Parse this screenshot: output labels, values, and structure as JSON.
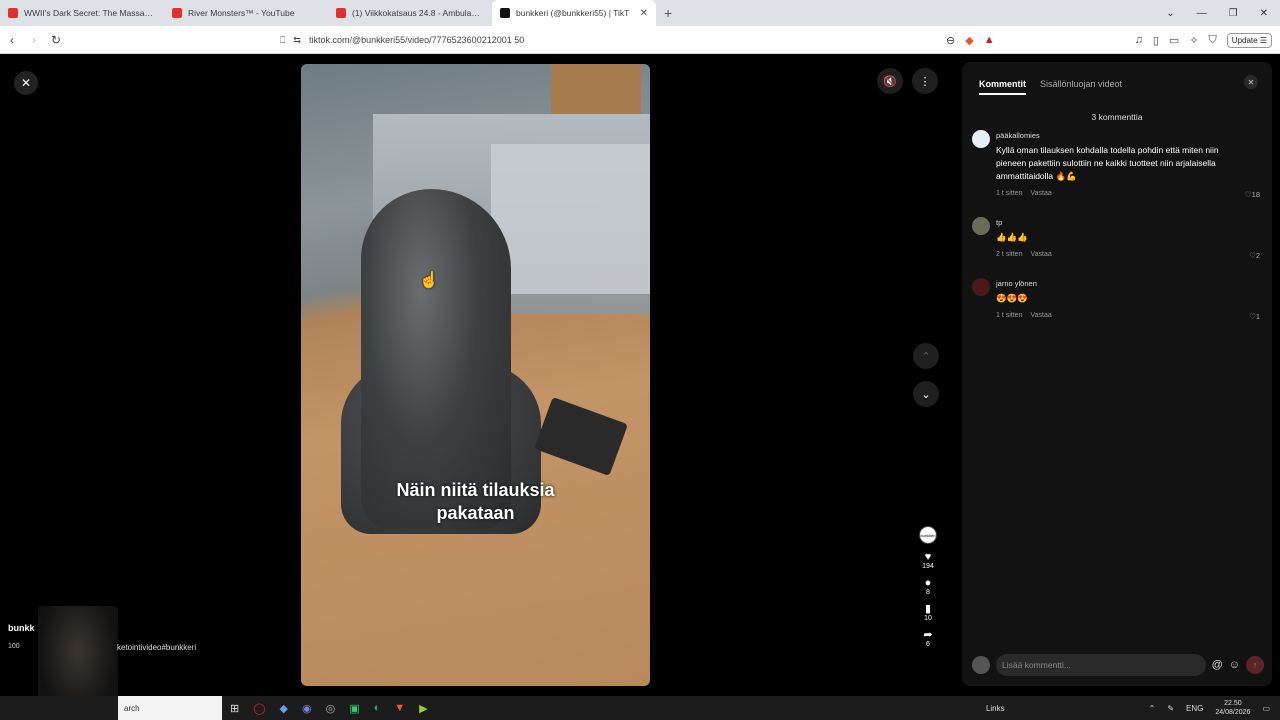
{
  "browser": {
    "tabs": [
      {
        "title": "WWII's Dark Secret: The Massacre of",
        "fav_color": "#e03030"
      },
      {
        "title": "River Monsters™ - YouTube",
        "fav_color": "#e03030"
      },
      {
        "title": "(1) Viikkokatsaus 24.8 - Ambulanssia",
        "fav_color": "#e03030"
      },
      {
        "title": "bunkkeri (@bunkkeri55) | TikT",
        "fav_color": "#111111",
        "active": true
      }
    ],
    "new_tab": "+",
    "url": "tiktok.com/@bunkkeri55/video/7776523600212001 50",
    "update_label": "Update"
  },
  "viewer": {
    "caption_line1": "Näin niitä tilauksia",
    "caption_line2": "pakataan",
    "creator_avatar_text": "bunkkeri",
    "likes": "194",
    "comments": "8",
    "saves": "10",
    "shares": "6"
  },
  "overlay": {
    "name": "bunkk",
    "count": "100",
    "desc": "ketointivideo#bunkkeri"
  },
  "panel": {
    "tab_comments": "Kommentit",
    "tab_creator_videos": "Sisällönluojan videot",
    "comment_count": "3 kommenttia",
    "comments": [
      {
        "user": "pääkallomies",
        "text": "Kyllä oman tilauksen kohdalla todella pohdin että miten niin pieneen pakettiin sulottiin ne kaikki tuotteet niin arjalaisella ammattitaidolla 🔥💪",
        "time": "1 t sitten",
        "reply": "Vastaa",
        "likes": "18",
        "avatar_color": "#e8eef5"
      },
      {
        "user": "tp",
        "text": "👍👍👍",
        "time": "2 t sitten",
        "reply": "Vastaa",
        "likes": "2",
        "avatar_color": "#6b6b5a"
      },
      {
        "user": "jarno ylönen",
        "text": "😍😍😍",
        "time": "1 t sitten",
        "reply": "Vastaa",
        "likes": "1",
        "avatar_color": "#4a1a1a"
      }
    ],
    "input_placeholder": "Lisää kommentti..."
  },
  "taskbar": {
    "search_label": "arch",
    "links_label": "Links",
    "lang": "ENG",
    "time": "22.50",
    "date": "24/08/2026"
  }
}
